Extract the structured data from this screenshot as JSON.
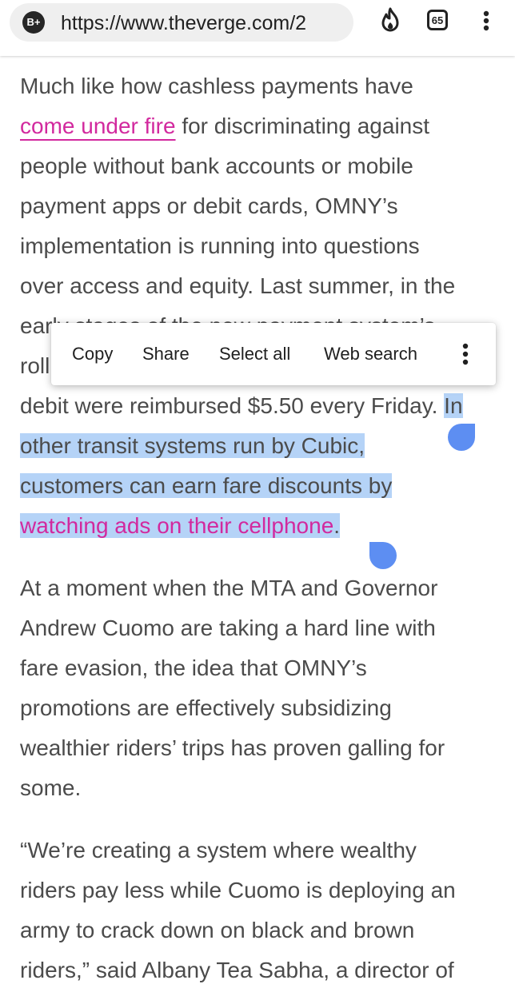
{
  "browser": {
    "badge_label": "B+",
    "url": "https://www.theverge.com/2",
    "tab_count": "65",
    "icons": [
      "fire-icon",
      "tab-counter-icon",
      "more-vert-icon"
    ]
  },
  "article": {
    "p1": {
      "l1": "Much like how cashless payments have",
      "l2_link": "come under fire",
      "l2_rest": " for discriminating against",
      "l3": "people without bank accounts or mobile",
      "l4": "payment apps or debit cards, OMNY’s",
      "l5": "implementation is running into questions",
      "l6": "over access and equity. Last summer, in the",
      "l7": "early stages of the new payment system’s",
      "l8": "roll",
      "l9_plain": "debit were reimbursed $5.50 every Friday. ",
      "l9_sel": "In",
      "l10": "other transit systems run by Cubic,",
      "l11": "customers can earn fare discounts by",
      "l12_link": "watching ads on their cellphone",
      "l12_end": "."
    },
    "p2": {
      "l1": "At a moment when the MTA and Governor",
      "l2": "Andrew Cuomo are taking a hard line with",
      "l3": "fare evasion, the idea that OMNY’s",
      "l4": "promotions are effectively subsidizing",
      "l5": "wealthier riders’ trips has proven galling for",
      "l6": "some."
    },
    "p3": {
      "l1": "“We’re creating a system where wealthy",
      "l2": "riders pay less while Cuomo is deploying an",
      "l3": "army to crack down on black and brown",
      "l4": "riders,” said Albany Tea Sabha, a director of"
    }
  },
  "context_menu": {
    "copy": "Copy",
    "share": "Share",
    "select_all": "Select all",
    "web_search": "Web search"
  },
  "colors": {
    "link": "#d2299e",
    "selection": "#b5d3f7",
    "handle": "#5d8ef2",
    "body_text": "#4b4b4b"
  }
}
